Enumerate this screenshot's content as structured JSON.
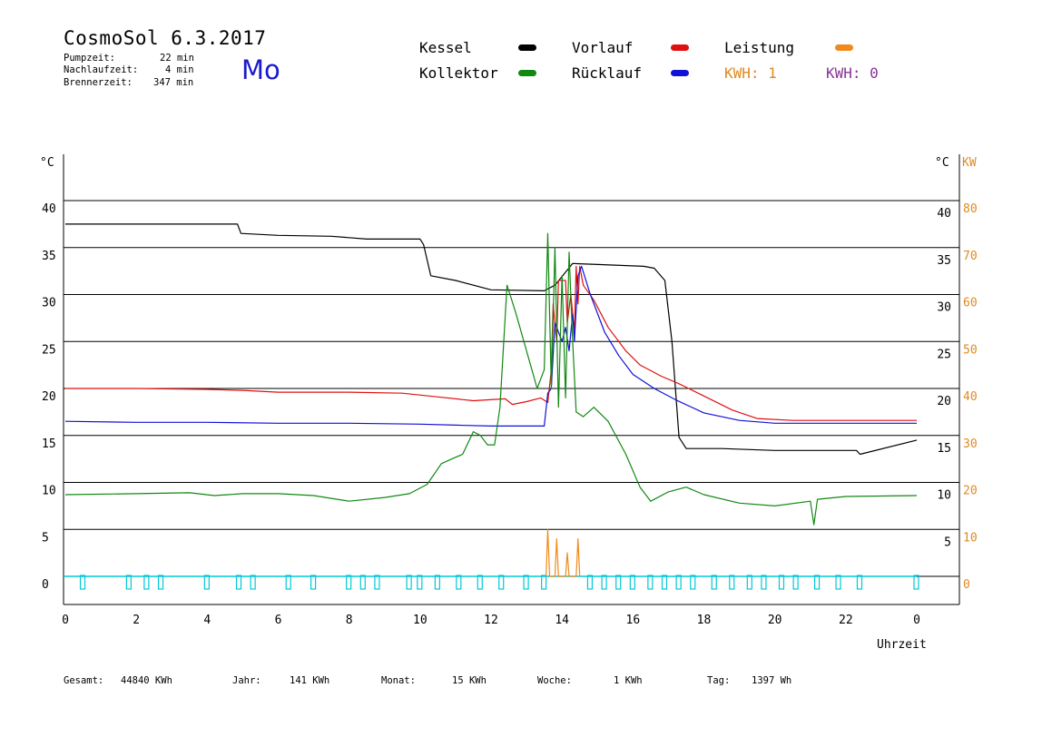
{
  "header": {
    "title": "CosmoSol 6.3.2017",
    "day": "Mo",
    "stats": [
      {
        "label": "Pumpzeit:",
        "value": "22 min"
      },
      {
        "label": "Nachlaufzeit:",
        "value": "4 min"
      },
      {
        "label": "Brennerzeit:",
        "value": "347 min"
      }
    ]
  },
  "legend": {
    "kessel": {
      "label": "Kessel",
      "color": "#000000"
    },
    "vorlauf": {
      "label": "Vorlauf",
      "color": "#e01010"
    },
    "leistung": {
      "label": "Leistung",
      "color": "#f08a1a"
    },
    "kollektor": {
      "label": "Kollektor",
      "color": "#118811"
    },
    "ruecklauf": {
      "label": "Rücklauf",
      "color": "#1010d8"
    },
    "kwh1": {
      "label": "KWH: 1",
      "color": "#e08a20"
    },
    "kwh2": {
      "label": "KWH: 0",
      "color": "#883399"
    }
  },
  "footer": {
    "gesamt": {
      "label": "Gesamt:",
      "value": "44840 KWh"
    },
    "jahr": {
      "label": "Jahr:",
      "value": "141 KWh"
    },
    "monat": {
      "label": "Monat:",
      "value": "15 KWh"
    },
    "woche": {
      "label": "Woche:",
      "value": "1 KWh"
    },
    "tag": {
      "label": "Tag:",
      "value": "1397 Wh"
    }
  },
  "chart_data": {
    "type": "line",
    "xlabel": "Uhrzeit",
    "ylabel_left": "°C",
    "ylabel_right": [
      "°C",
      "KW"
    ],
    "xlim": [
      0,
      24
    ],
    "ylim": [
      0,
      40
    ],
    "x_ticks": [
      "0",
      "2",
      "4",
      "6",
      "8",
      "10",
      "12",
      "14",
      "16",
      "18",
      "20",
      "22",
      "0"
    ],
    "y_ticks_left": [
      "0",
      "5",
      "10",
      "15",
      "20",
      "25",
      "30",
      "35",
      "40"
    ],
    "y_ticks_right_temp": [
      "5",
      "10",
      "15",
      "20",
      "25",
      "30",
      "35",
      "40"
    ],
    "y_ticks_right_kw": [
      "0",
      "10",
      "20",
      "30",
      "40",
      "50",
      "60",
      "70",
      "80"
    ],
    "grid": true,
    "series": [
      {
        "name": "Kessel",
        "color": "#000000",
        "points": [
          [
            0,
            37.5
          ],
          [
            4.85,
            37.5
          ],
          [
            4.95,
            36.5
          ],
          [
            6,
            36.3
          ],
          [
            7.5,
            36.2
          ],
          [
            8.5,
            35.9
          ],
          [
            10.0,
            35.9
          ],
          [
            10.1,
            35.3
          ],
          [
            10.3,
            32.0
          ],
          [
            11,
            31.5
          ],
          [
            12,
            30.5
          ],
          [
            13.5,
            30.4
          ],
          [
            13.8,
            31.0
          ],
          [
            14.3,
            33.3
          ],
          [
            15,
            33.2
          ],
          [
            16.3,
            33.0
          ],
          [
            16.6,
            32.8
          ],
          [
            16.9,
            31.5
          ],
          [
            17.1,
            25
          ],
          [
            17.3,
            14.8
          ],
          [
            17.5,
            13.6
          ],
          [
            18.5,
            13.6
          ],
          [
            20,
            13.4
          ],
          [
            22.3,
            13.4
          ],
          [
            22.4,
            13.0
          ],
          [
            24,
            14.5
          ]
        ]
      },
      {
        "name": "Vorlauf",
        "color": "#e01010",
        "points": [
          [
            0,
            20.0
          ],
          [
            2,
            20.0
          ],
          [
            4,
            19.9
          ],
          [
            5,
            19.8
          ],
          [
            6,
            19.6
          ],
          [
            8,
            19.6
          ],
          [
            9.5,
            19.5
          ],
          [
            10.5,
            19.1
          ],
          [
            11.5,
            18.7
          ],
          [
            12.4,
            18.9
          ],
          [
            12.6,
            18.3
          ],
          [
            13,
            18.6
          ],
          [
            13.4,
            19.0
          ],
          [
            13.6,
            18.5
          ],
          [
            13.7,
            22
          ],
          [
            13.75,
            29
          ],
          [
            13.85,
            25
          ],
          [
            13.9,
            31.5
          ],
          [
            14.1,
            31.5
          ],
          [
            14.15,
            27
          ],
          [
            14.25,
            30
          ],
          [
            14.35,
            26
          ],
          [
            14.4,
            33
          ],
          [
            14.45,
            29
          ],
          [
            14.5,
            33
          ],
          [
            14.6,
            31
          ],
          [
            14.9,
            29.4
          ],
          [
            15.3,
            26.5
          ],
          [
            15.8,
            24.0
          ],
          [
            16.2,
            22.5
          ],
          [
            16.8,
            21.3
          ],
          [
            17.3,
            20.5
          ],
          [
            18,
            19.2
          ],
          [
            18.8,
            17.7
          ],
          [
            19.5,
            16.8
          ],
          [
            20.5,
            16.6
          ],
          [
            22,
            16.6
          ],
          [
            24,
            16.6
          ]
        ]
      },
      {
        "name": "Rücklauf",
        "color": "#1010d8",
        "points": [
          [
            0,
            16.5
          ],
          [
            2,
            16.4
          ],
          [
            4,
            16.4
          ],
          [
            6,
            16.3
          ],
          [
            8,
            16.3
          ],
          [
            10,
            16.2
          ],
          [
            11,
            16.1
          ],
          [
            12,
            16.0
          ],
          [
            13.5,
            16.0
          ],
          [
            13.6,
            19.5
          ],
          [
            13.7,
            20
          ],
          [
            13.8,
            27
          ],
          [
            13.9,
            26
          ],
          [
            14.0,
            25
          ],
          [
            14.1,
            26.5
          ],
          [
            14.2,
            24
          ],
          [
            14.3,
            28
          ],
          [
            14.35,
            25
          ],
          [
            14.45,
            32
          ],
          [
            14.55,
            33
          ],
          [
            14.8,
            30
          ],
          [
            15.2,
            26
          ],
          [
            15.6,
            23.5
          ],
          [
            16,
            21.5
          ],
          [
            16.6,
            20
          ],
          [
            17.2,
            18.8
          ],
          [
            18,
            17.4
          ],
          [
            19,
            16.6
          ],
          [
            20,
            16.3
          ],
          [
            22,
            16.3
          ],
          [
            24,
            16.3
          ]
        ]
      },
      {
        "name": "Kollektor",
        "color": "#118811",
        "points": [
          [
            0,
            8.7
          ],
          [
            2,
            8.8
          ],
          [
            3.5,
            8.9
          ],
          [
            4.2,
            8.6
          ],
          [
            5,
            8.8
          ],
          [
            6,
            8.8
          ],
          [
            7,
            8.6
          ],
          [
            7.5,
            8.3
          ],
          [
            8,
            8.0
          ],
          [
            9,
            8.4
          ],
          [
            9.7,
            8.8
          ],
          [
            10.2,
            9.8
          ],
          [
            10.6,
            12.0
          ],
          [
            10.9,
            12.5
          ],
          [
            11.2,
            13.0
          ],
          [
            11.5,
            15.4
          ],
          [
            11.7,
            15.0
          ],
          [
            11.9,
            14.0
          ],
          [
            12.1,
            14.0
          ],
          [
            12.25,
            18
          ],
          [
            12.45,
            31.0
          ],
          [
            12.7,
            28
          ],
          [
            13.0,
            24
          ],
          [
            13.3,
            20
          ],
          [
            13.5,
            22
          ],
          [
            13.6,
            36.5
          ],
          [
            13.7,
            20
          ],
          [
            13.8,
            35
          ],
          [
            13.9,
            18
          ],
          [
            14.0,
            32
          ],
          [
            14.1,
            19
          ],
          [
            14.2,
            34.5
          ],
          [
            14.3,
            25
          ],
          [
            14.4,
            17.5
          ],
          [
            14.6,
            17.0
          ],
          [
            14.9,
            18.0
          ],
          [
            15.3,
            16.5
          ],
          [
            15.8,
            13.0
          ],
          [
            16.2,
            9.5
          ],
          [
            16.5,
            8.0
          ],
          [
            17.0,
            9.0
          ],
          [
            17.5,
            9.5
          ],
          [
            18.0,
            8.7
          ],
          [
            19,
            7.8
          ],
          [
            20,
            7.5
          ],
          [
            21.0,
            8.0
          ],
          [
            21.1,
            5.5
          ],
          [
            21.2,
            8.2
          ],
          [
            22,
            8.5
          ],
          [
            24,
            8.6
          ]
        ]
      },
      {
        "name": "Leistung",
        "color": "#f08a1a",
        "points": [
          [
            13.55,
            0
          ],
          [
            13.6,
            5
          ],
          [
            13.65,
            0
          ],
          [
            13.8,
            0
          ],
          [
            13.85,
            4
          ],
          [
            13.9,
            0
          ],
          [
            14.1,
            0
          ],
          [
            14.15,
            2.5
          ],
          [
            14.2,
            0
          ],
          [
            14.4,
            0
          ],
          [
            14.45,
            4
          ],
          [
            14.5,
            0
          ]
        ]
      },
      {
        "name": "Pumpe",
        "color": "#00c8d8",
        "points": [
          [
            0,
            0
          ],
          [
            24,
            0
          ]
        ]
      }
    ]
  }
}
